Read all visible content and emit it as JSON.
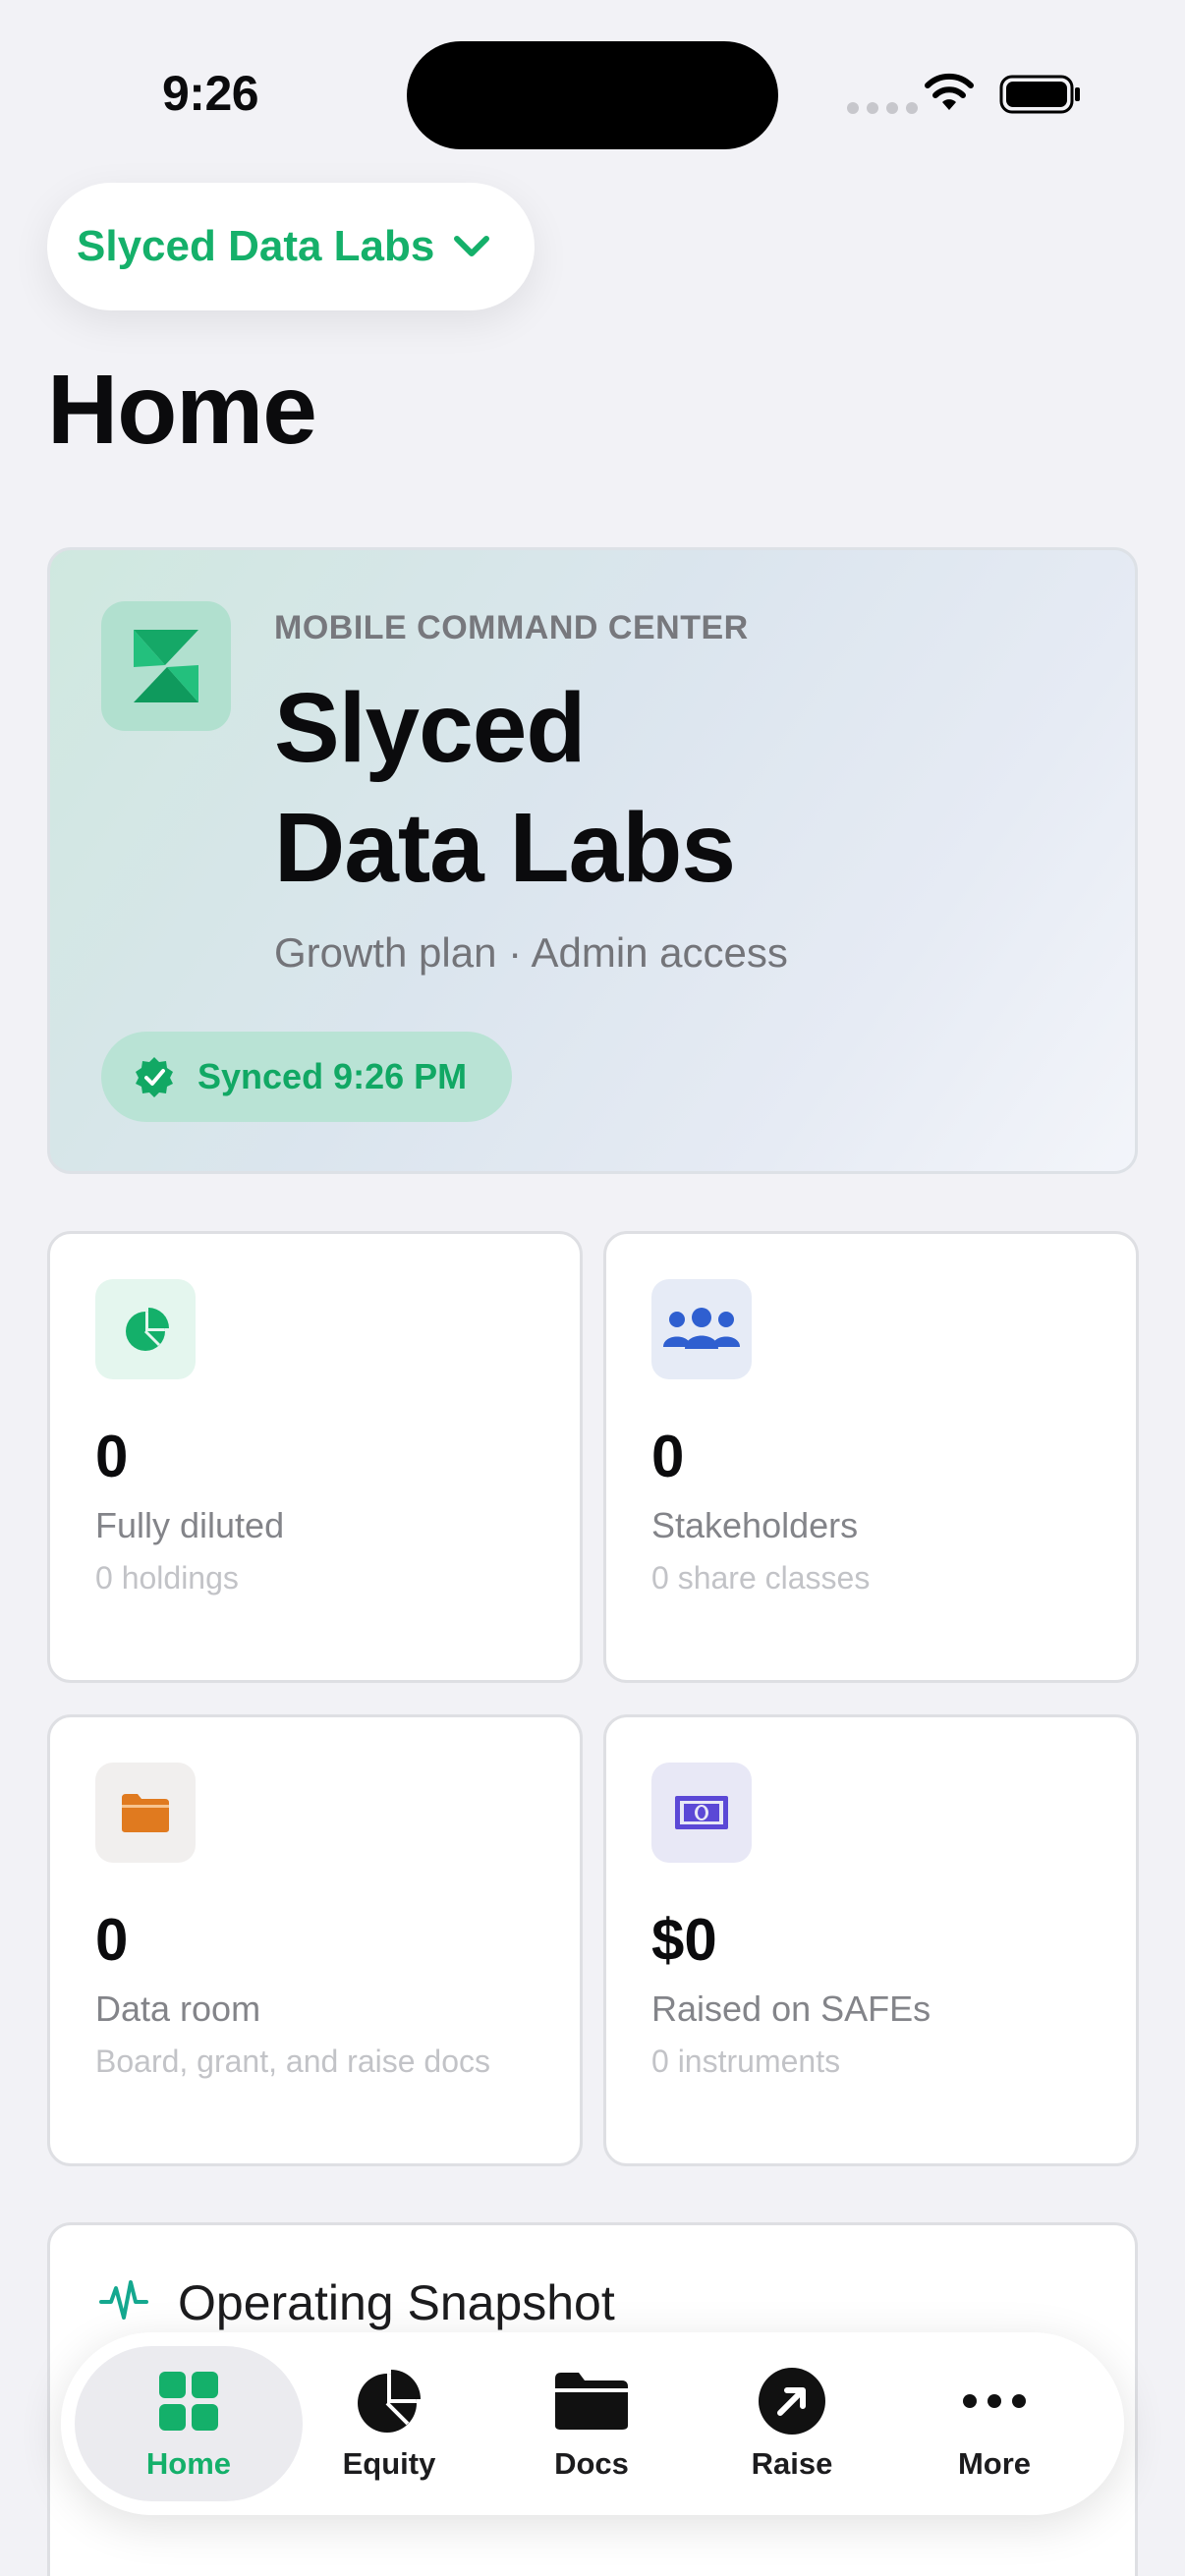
{
  "status_bar": {
    "time": "9:26"
  },
  "org_switcher": {
    "label": "Slyced Data Labs"
  },
  "page": {
    "title": "Home"
  },
  "hero": {
    "eyebrow": "MOBILE COMMAND CENTER",
    "name_line1": "Slyced",
    "name_line2": "Data Labs",
    "plan": "Growth plan · Admin access",
    "sync_label": "Synced 9:26 PM"
  },
  "stats": [
    {
      "value": "0",
      "label": "Fully diluted",
      "sub": "0 holdings",
      "icon": "pie-chart-icon",
      "icon_color": "#14b06a"
    },
    {
      "value": "0",
      "label": "Stakeholders",
      "sub": "0 share classes",
      "icon": "people-icon",
      "icon_color": "#2f5fd0"
    },
    {
      "value": "0",
      "label": "Data room",
      "sub": "Board, grant, and raise docs",
      "icon": "folder-icon",
      "icon_color": "#e07a1f"
    },
    {
      "value": "$0",
      "label": "Raised on SAFEs",
      "sub": "0 instruments",
      "icon": "banknote-icon",
      "icon_color": "#5b48d6"
    }
  ],
  "snapshot": {
    "title": "Operating Snapshot",
    "subtitle": ""
  },
  "tabs": [
    {
      "label": "Home",
      "icon": "grid-icon",
      "active": true
    },
    {
      "label": "Equity",
      "icon": "pie-chart-icon",
      "active": false
    },
    {
      "label": "Docs",
      "icon": "folder-icon",
      "active": false
    },
    {
      "label": "Raise",
      "icon": "arrow-up-right-icon",
      "active": false
    },
    {
      "label": "More",
      "icon": "ellipsis-icon",
      "active": false
    }
  ],
  "colors": {
    "accent": "#14b06a",
    "background": "#f2f2f6"
  }
}
